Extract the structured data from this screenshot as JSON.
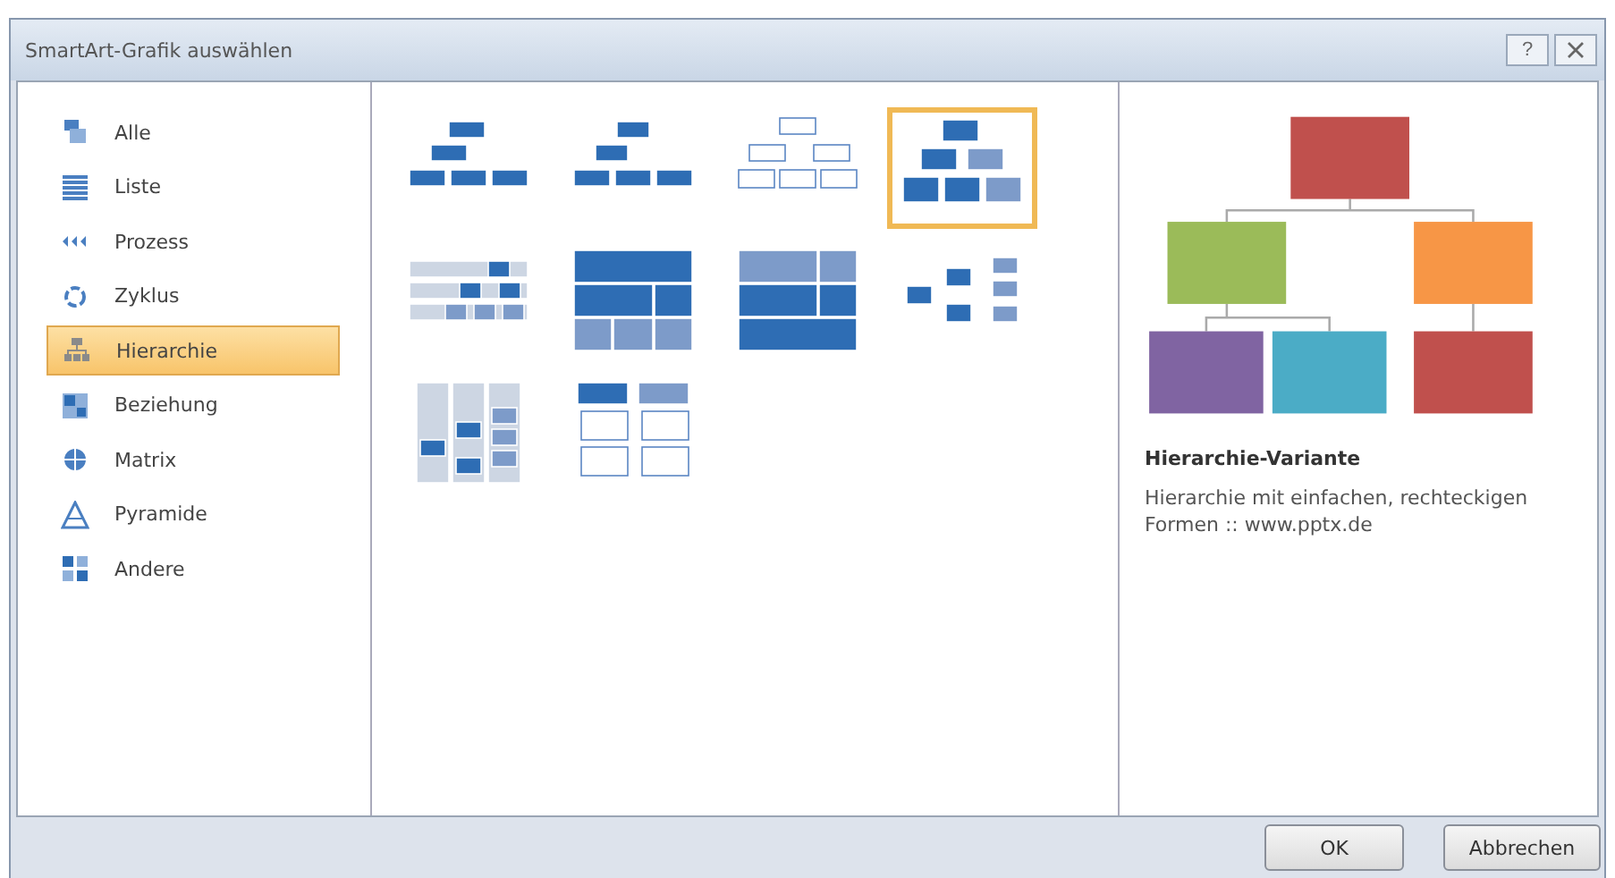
{
  "window": {
    "title": "SmartArt-Grafik auswählen",
    "help_button": "?"
  },
  "categories": [
    {
      "label": "Alle",
      "selected": false
    },
    {
      "label": "Liste",
      "selected": false
    },
    {
      "label": "Prozess",
      "selected": false
    },
    {
      "label": "Zyklus",
      "selected": false
    },
    {
      "label": "Hierarchie",
      "selected": true
    },
    {
      "label": "Beziehung",
      "selected": false
    },
    {
      "label": "Matrix",
      "selected": false
    },
    {
      "label": "Pyramide",
      "selected": false
    },
    {
      "label": "Andere",
      "selected": false
    }
  ],
  "gallery": [
    {
      "selected": false
    },
    {
      "selected": false
    },
    {
      "selected": false
    },
    {
      "selected": true
    },
    {
      "selected": false
    },
    {
      "selected": false
    },
    {
      "selected": false
    },
    {
      "selected": false
    },
    {
      "selected": false
    },
    {
      "selected": false
    }
  ],
  "preview": {
    "nodes": [
      {
        "color": "#c0504d"
      },
      {
        "color": "#9bbb59"
      },
      {
        "color": "#f79646"
      },
      {
        "color": "#8064a2"
      },
      {
        "color": "#4bacc6"
      },
      {
        "color": "#c0504d"
      }
    ],
    "title": "Hierarchie-Variante",
    "description": "Hierarchie mit einfachen, rechteckigen Formen :: www.pptx.de"
  },
  "buttons": [
    "OK",
    "Abbrechen"
  ]
}
